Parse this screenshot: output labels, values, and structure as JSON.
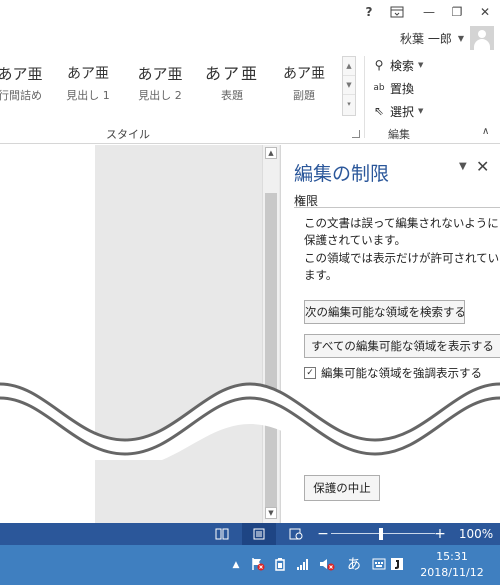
{
  "titlebar": {
    "help_icon": "?",
    "ribbon_display_icon": "ribbon-display-options",
    "minimize_icon": "—",
    "restore_icon": "❐",
    "close_icon": "✕"
  },
  "account": {
    "name": "秋葉 一郎"
  },
  "ribbon": {
    "styles": [
      {
        "sample": "あア亜",
        "label": "行間詰め"
      },
      {
        "sample": "あア亜",
        "label": "見出し 1"
      },
      {
        "sample": "あア亜",
        "label": "見出し 2"
      },
      {
        "sample": "あア亜",
        "label": "表題"
      },
      {
        "sample": "あア亜",
        "label": "副題"
      }
    ],
    "styles_group_label": "スタイル",
    "editing_group_label": "編集",
    "editing": {
      "find": "検索",
      "replace": "置換",
      "select": "選択"
    }
  },
  "pane": {
    "title": "編集の制限",
    "heading": "権限",
    "message1": "この文書は誤って編集されないように保護されています。",
    "message2": "この領域では表示だけが許可されています。",
    "find_next_button": "次の編集可能な領域を検索する",
    "show_all_button": "すべての編集可能な領域を表示する",
    "highlight_checkbox": "編集可能な領域を強調表示する",
    "highlight_checked": true,
    "stop_protection_button": "保護の中止"
  },
  "statusbar": {
    "zoom_level": "100%",
    "zoom_minus": "−",
    "zoom_plus": "+"
  },
  "taskbar": {
    "ime_mode": "あ",
    "time": "15:31",
    "date": "2018/11/12"
  },
  "colors": {
    "accent": "#2b579a",
    "taskbar": "#3f7fc0"
  }
}
